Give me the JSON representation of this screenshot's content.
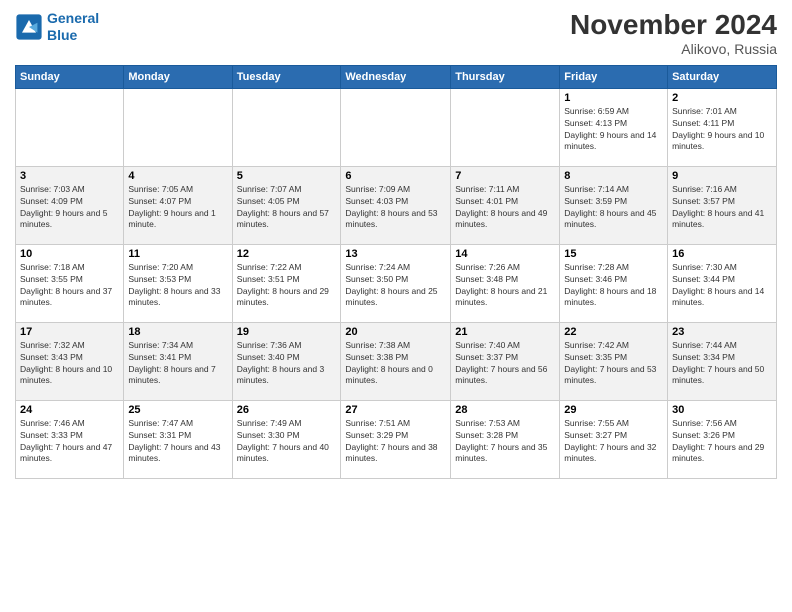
{
  "logo": {
    "line1": "General",
    "line2": "Blue"
  },
  "title": "November 2024",
  "location": "Alikovo, Russia",
  "days_of_week": [
    "Sunday",
    "Monday",
    "Tuesday",
    "Wednesday",
    "Thursday",
    "Friday",
    "Saturday"
  ],
  "weeks": [
    [
      {
        "day": "",
        "info": ""
      },
      {
        "day": "",
        "info": ""
      },
      {
        "day": "",
        "info": ""
      },
      {
        "day": "",
        "info": ""
      },
      {
        "day": "",
        "info": ""
      },
      {
        "day": "1",
        "info": "Sunrise: 6:59 AM\nSunset: 4:13 PM\nDaylight: 9 hours and 14 minutes."
      },
      {
        "day": "2",
        "info": "Sunrise: 7:01 AM\nSunset: 4:11 PM\nDaylight: 9 hours and 10 minutes."
      }
    ],
    [
      {
        "day": "3",
        "info": "Sunrise: 7:03 AM\nSunset: 4:09 PM\nDaylight: 9 hours and 5 minutes."
      },
      {
        "day": "4",
        "info": "Sunrise: 7:05 AM\nSunset: 4:07 PM\nDaylight: 9 hours and 1 minute."
      },
      {
        "day": "5",
        "info": "Sunrise: 7:07 AM\nSunset: 4:05 PM\nDaylight: 8 hours and 57 minutes."
      },
      {
        "day": "6",
        "info": "Sunrise: 7:09 AM\nSunset: 4:03 PM\nDaylight: 8 hours and 53 minutes."
      },
      {
        "day": "7",
        "info": "Sunrise: 7:11 AM\nSunset: 4:01 PM\nDaylight: 8 hours and 49 minutes."
      },
      {
        "day": "8",
        "info": "Sunrise: 7:14 AM\nSunset: 3:59 PM\nDaylight: 8 hours and 45 minutes."
      },
      {
        "day": "9",
        "info": "Sunrise: 7:16 AM\nSunset: 3:57 PM\nDaylight: 8 hours and 41 minutes."
      }
    ],
    [
      {
        "day": "10",
        "info": "Sunrise: 7:18 AM\nSunset: 3:55 PM\nDaylight: 8 hours and 37 minutes."
      },
      {
        "day": "11",
        "info": "Sunrise: 7:20 AM\nSunset: 3:53 PM\nDaylight: 8 hours and 33 minutes."
      },
      {
        "day": "12",
        "info": "Sunrise: 7:22 AM\nSunset: 3:51 PM\nDaylight: 8 hours and 29 minutes."
      },
      {
        "day": "13",
        "info": "Sunrise: 7:24 AM\nSunset: 3:50 PM\nDaylight: 8 hours and 25 minutes."
      },
      {
        "day": "14",
        "info": "Sunrise: 7:26 AM\nSunset: 3:48 PM\nDaylight: 8 hours and 21 minutes."
      },
      {
        "day": "15",
        "info": "Sunrise: 7:28 AM\nSunset: 3:46 PM\nDaylight: 8 hours and 18 minutes."
      },
      {
        "day": "16",
        "info": "Sunrise: 7:30 AM\nSunset: 3:44 PM\nDaylight: 8 hours and 14 minutes."
      }
    ],
    [
      {
        "day": "17",
        "info": "Sunrise: 7:32 AM\nSunset: 3:43 PM\nDaylight: 8 hours and 10 minutes."
      },
      {
        "day": "18",
        "info": "Sunrise: 7:34 AM\nSunset: 3:41 PM\nDaylight: 8 hours and 7 minutes."
      },
      {
        "day": "19",
        "info": "Sunrise: 7:36 AM\nSunset: 3:40 PM\nDaylight: 8 hours and 3 minutes."
      },
      {
        "day": "20",
        "info": "Sunrise: 7:38 AM\nSunset: 3:38 PM\nDaylight: 8 hours and 0 minutes."
      },
      {
        "day": "21",
        "info": "Sunrise: 7:40 AM\nSunset: 3:37 PM\nDaylight: 7 hours and 56 minutes."
      },
      {
        "day": "22",
        "info": "Sunrise: 7:42 AM\nSunset: 3:35 PM\nDaylight: 7 hours and 53 minutes."
      },
      {
        "day": "23",
        "info": "Sunrise: 7:44 AM\nSunset: 3:34 PM\nDaylight: 7 hours and 50 minutes."
      }
    ],
    [
      {
        "day": "24",
        "info": "Sunrise: 7:46 AM\nSunset: 3:33 PM\nDaylight: 7 hours and 47 minutes."
      },
      {
        "day": "25",
        "info": "Sunrise: 7:47 AM\nSunset: 3:31 PM\nDaylight: 7 hours and 43 minutes."
      },
      {
        "day": "26",
        "info": "Sunrise: 7:49 AM\nSunset: 3:30 PM\nDaylight: 7 hours and 40 minutes."
      },
      {
        "day": "27",
        "info": "Sunrise: 7:51 AM\nSunset: 3:29 PM\nDaylight: 7 hours and 38 minutes."
      },
      {
        "day": "28",
        "info": "Sunrise: 7:53 AM\nSunset: 3:28 PM\nDaylight: 7 hours and 35 minutes."
      },
      {
        "day": "29",
        "info": "Sunrise: 7:55 AM\nSunset: 3:27 PM\nDaylight: 7 hours and 32 minutes."
      },
      {
        "day": "30",
        "info": "Sunrise: 7:56 AM\nSunset: 3:26 PM\nDaylight: 7 hours and 29 minutes."
      }
    ]
  ]
}
